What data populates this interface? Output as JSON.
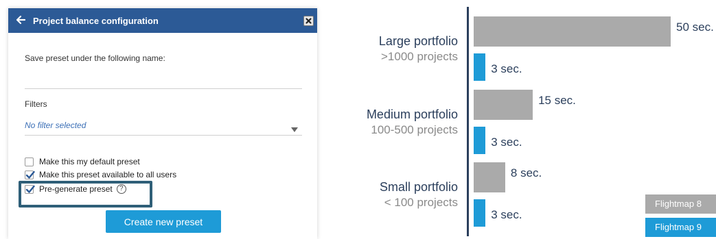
{
  "dialog": {
    "title": "Project balance configuration",
    "save_prompt": "Save preset under the following name:",
    "name_value": "",
    "filters_label": "Filters",
    "filter_value": "No filter selected",
    "checkboxes": [
      {
        "label": "Make this my default preset",
        "checked": false
      },
      {
        "label": "Make this preset available to all users",
        "checked": true
      },
      {
        "label": "Pre-generate preset",
        "checked": true
      }
    ],
    "help_glyph": "?",
    "create_button": "Create new preset",
    "header_color": "#2c5a96",
    "button_color": "#1e9bd7"
  },
  "chart_data": {
    "type": "bar",
    "orientation": "horizontal",
    "categories": [
      {
        "title": "Large portfolio",
        "subtitle": ">1000 projects"
      },
      {
        "title": "Medium portfolio",
        "subtitle": "100-500 projects"
      },
      {
        "title": "Small portfolio",
        "subtitle": "< 100 projects"
      }
    ],
    "series": [
      {
        "name": "Flightmap 8",
        "color": "#aaaaaa",
        "values": [
          50,
          15,
          8
        ],
        "labels": [
          "50 sec.",
          "15 sec.",
          "8 sec."
        ]
      },
      {
        "name": "Flightmap 9",
        "color": "#1e9bd7",
        "values": [
          3,
          3,
          3
        ],
        "labels": [
          "3 sec.",
          "3 sec.",
          "3 sec."
        ]
      }
    ],
    "legend": "bottom-right",
    "xlim": [
      0,
      50
    ]
  }
}
